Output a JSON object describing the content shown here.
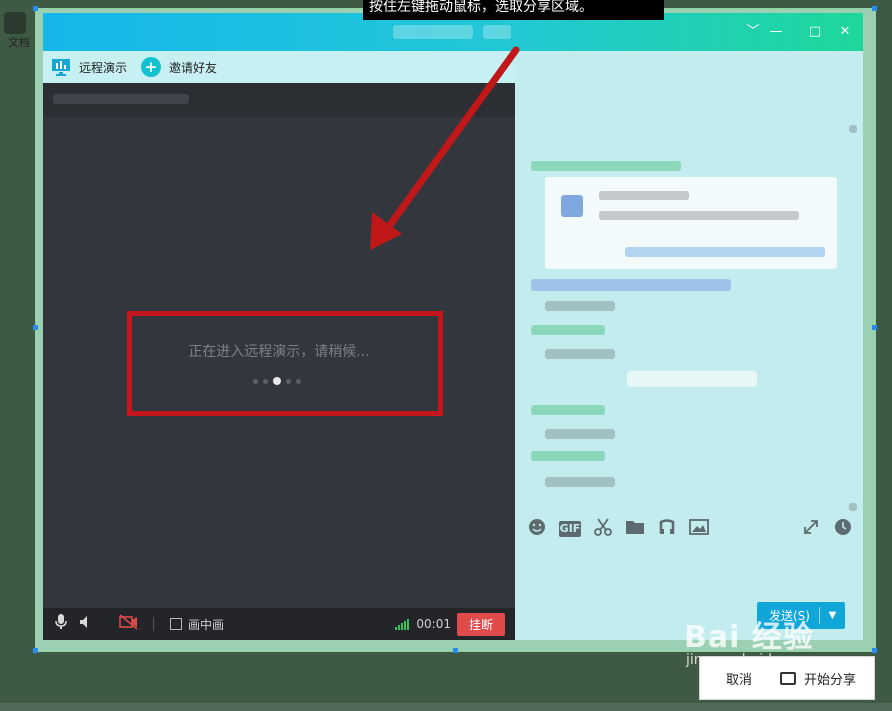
{
  "desktop": {
    "icon_label": "文档"
  },
  "tooltip": {
    "text": "按住左键拖动鼠标，选取分享区域。"
  },
  "window": {
    "controls": {
      "dropdown": "﹀",
      "minimize": "—",
      "maximize": "□",
      "close": "✕"
    }
  },
  "toolbar": {
    "remote_demo": "远程演示",
    "invite_friends": "邀请好友"
  },
  "video": {
    "loading_text": "正在进入远程演示，请稍候...",
    "dots": 5,
    "active_dot": 3
  },
  "callbar": {
    "mic_icon": "microphone-icon",
    "speaker_icon": "speaker-icon",
    "camera_icon": "camera-off-icon",
    "pip_label": "画中画",
    "timer": "00:01",
    "hangup_label": "挂断"
  },
  "chat_tools": {
    "icons": [
      "emoji-icon",
      "gif-icon",
      "scissors-icon",
      "folder-icon",
      "music-icon",
      "image-icon"
    ],
    "gif_label": "GIF"
  },
  "send": {
    "label": "发送(S)"
  },
  "share": {
    "cancel": "取消",
    "start": "开始分享"
  },
  "watermark": {
    "big": "Bai 经验",
    "small": "jingyan.baidu.com"
  },
  "colors": {
    "accent": "#11a6d8",
    "hangup": "#e04a4a",
    "highlight": "#c4161c",
    "signal": "#35c35a"
  }
}
